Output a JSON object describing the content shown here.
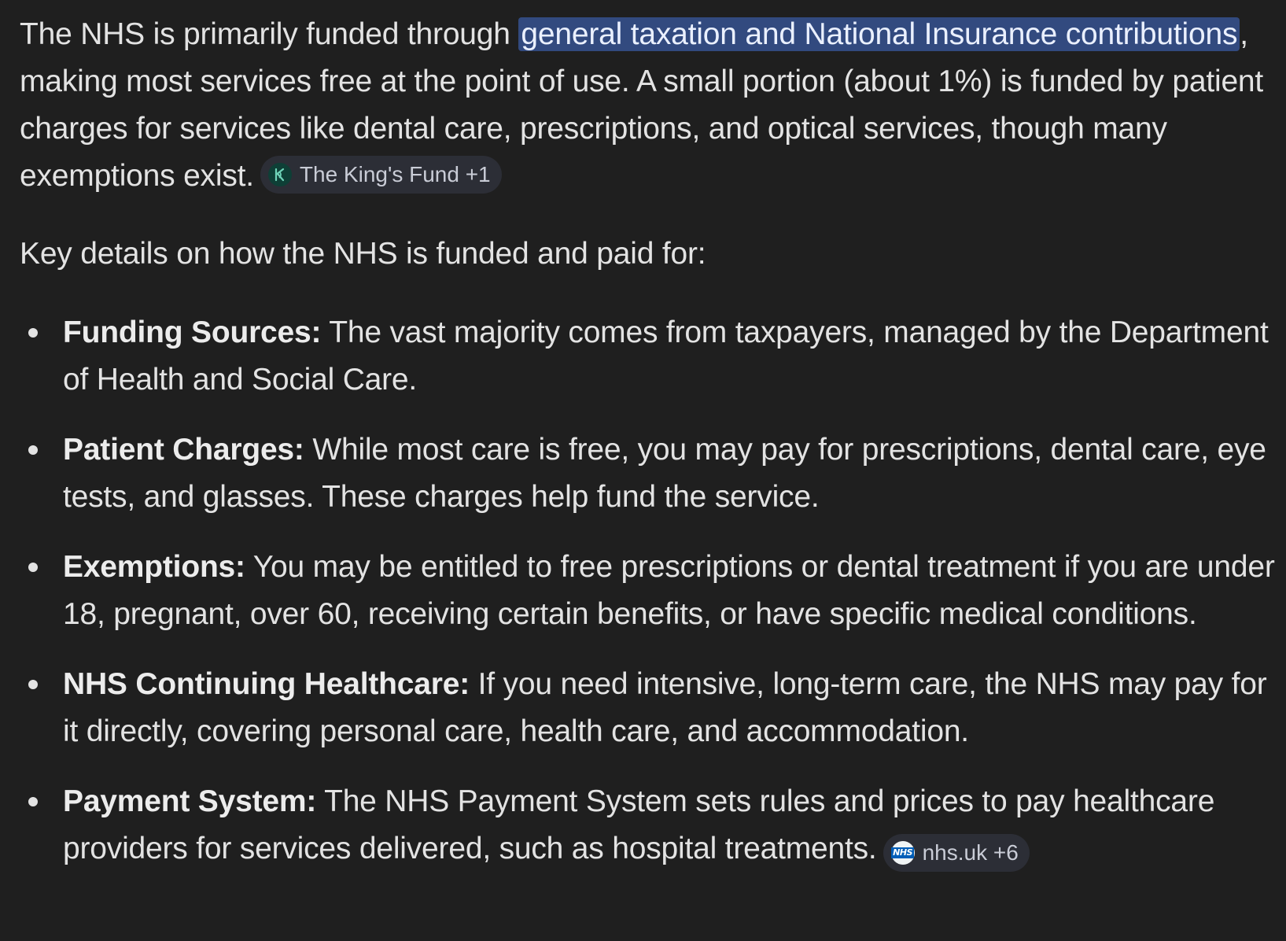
{
  "intro": {
    "before": "The NHS is primarily funded through ",
    "highlight": "general taxation and National Insurance contributions",
    "after": ", making most services free at the point of use. A small portion (about 1%) is funded by patient charges for services like dental care, prescriptions, and optical services, though many exemptions exist.",
    "citation": {
      "label": "The King's Fund +1",
      "icon": "kings-fund-logo-icon",
      "icon_glyph": "K"
    }
  },
  "lead": "Key details on how the NHS is funded and paid for:",
  "items": [
    {
      "title": "Funding Sources:",
      "text": " The vast majority comes from taxpayers, managed by the Department of Health and Social Care."
    },
    {
      "title": "Patient Charges:",
      "text": " While most care is free, you may pay for prescriptions, dental care, eye tests, and glasses. These charges help fund the service."
    },
    {
      "title": "Exemptions:",
      "text": " You may be entitled to free prescriptions or dental treatment if you are under 18, pregnant, over 60, receiving certain benefits, or have specific medical conditions."
    },
    {
      "title": "NHS Continuing Healthcare:",
      "text": " If you need intensive, long-term care, the NHS may pay for it directly, covering personal care, health care, and accommodation."
    },
    {
      "title": "Payment System:",
      "text": " The NHS Payment System sets rules and prices to pay healthcare providers for services delivered, such as hospital treatments.",
      "citation": {
        "label": "nhs.uk +6",
        "icon": "nhs-logo-icon",
        "icon_glyph": "NHS"
      }
    }
  ],
  "colors": {
    "background": "#1f1f1f",
    "text": "#e3e3e3",
    "highlight": "#324a7f",
    "chip_background": "#2c2e36",
    "nhs_blue": "#005eb8",
    "kings_fund_green": "#0e3f36"
  }
}
